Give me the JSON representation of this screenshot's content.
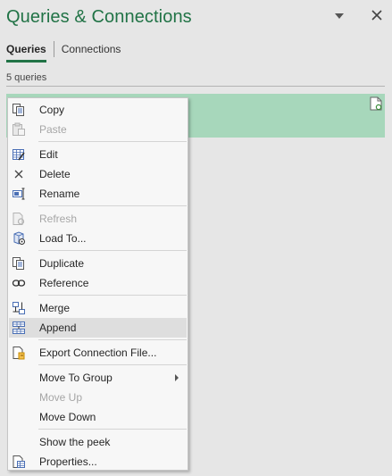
{
  "pane": {
    "title": "Queries & Connections",
    "accent_color": "#217346",
    "options_icon": "dropdown-arrow",
    "close_icon": "close-x"
  },
  "tabs": {
    "queries": "Queries",
    "connections": "Connections",
    "active": "Queries"
  },
  "queries_count": "5 queries",
  "selected_row_color": "#a7d7bb",
  "context_menu": {
    "hover_item": "Append",
    "items": {
      "copy": {
        "label": "Copy",
        "icon": "copy-icon",
        "enabled": true
      },
      "paste": {
        "label": "Paste",
        "icon": "paste-icon",
        "enabled": false
      },
      "edit": {
        "label": "Edit",
        "icon": "edit-table-icon",
        "enabled": true
      },
      "delete": {
        "label": "Delete",
        "icon": "delete-x-icon",
        "enabled": true
      },
      "rename": {
        "label": "Rename",
        "icon": "rename-icon",
        "enabled": true
      },
      "refresh": {
        "label": "Refresh",
        "icon": "refresh-icon",
        "enabled": false
      },
      "load_to": {
        "label": "Load To...",
        "icon": "load-to-icon",
        "enabled": true
      },
      "duplicate": {
        "label": "Duplicate",
        "icon": "duplicate-icon",
        "enabled": true
      },
      "reference": {
        "label": "Reference",
        "icon": "reference-link-icon",
        "enabled": true
      },
      "merge": {
        "label": "Merge",
        "icon": "merge-icon",
        "enabled": true
      },
      "append": {
        "label": "Append",
        "icon": "append-icon",
        "enabled": true
      },
      "export_connection": {
        "label": "Export Connection File...",
        "icon": "export-file-icon",
        "enabled": true
      },
      "move_to_group": {
        "label": "Move To Group",
        "icon": "",
        "enabled": true,
        "submenu": true
      },
      "move_up": {
        "label": "Move Up",
        "icon": "",
        "enabled": false
      },
      "move_down": {
        "label": "Move Down",
        "icon": "",
        "enabled": true
      },
      "show_peek": {
        "label": "Show the peek",
        "icon": "",
        "enabled": true
      },
      "properties": {
        "label": "Properties...",
        "icon": "properties-icon",
        "enabled": true
      }
    }
  }
}
